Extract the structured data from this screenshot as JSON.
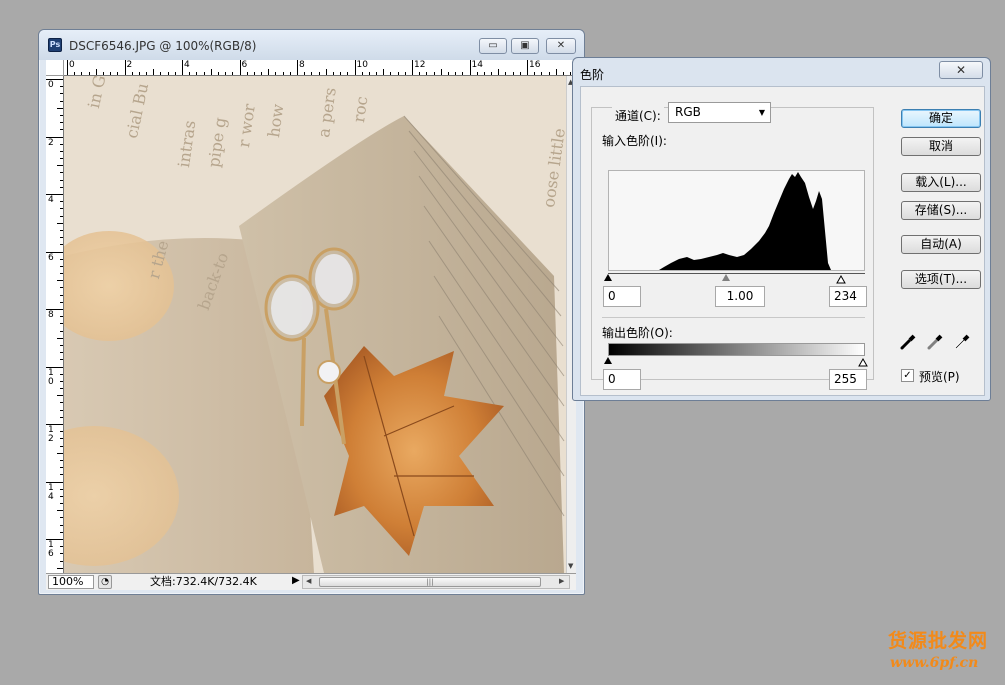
{
  "document_window": {
    "title": "DSCF6546.JPG @ 100%(RGB/8)",
    "app_icon": "Ps",
    "buttons": {
      "minimize": "▭",
      "maximize": "▣",
      "close": "✕"
    },
    "ruler_h_labels": [
      "0",
      "2",
      "4",
      "6",
      "8",
      "10",
      "12",
      "14",
      "16"
    ],
    "ruler_v_labels": [
      "0",
      "2",
      "4",
      "6",
      "8",
      "10",
      "12",
      "14",
      "16"
    ],
    "status": {
      "zoom": "100%",
      "doc_size": "文档:732.4K/732.4K",
      "nav_icon": "navigator-icon"
    },
    "canvas_texts": [
      "in Guan",
      "cial Bu",
      "intras",
      "pipe g",
      "r wor",
      "back-to",
      "r the",
      "how",
      "a pers",
      "oose little",
      "roc"
    ]
  },
  "levels_dialog": {
    "title": "色阶",
    "close": "✕",
    "channel_label": "通道(C):",
    "channel_value": "RGB",
    "input_label": "输入色阶(I):",
    "input_values": {
      "black": "0",
      "gamma": "1.00",
      "white": "234"
    },
    "output_label": "输出色阶(O):",
    "output_values": {
      "black": "0",
      "white": "255"
    },
    "buttons": {
      "ok": "确定",
      "cancel": "取消",
      "load": "载入(L)...",
      "save": "存储(S)...",
      "auto": "自动(A)",
      "options": "选项(T)..."
    },
    "preview_label": "预览(P)",
    "preview_checked": true,
    "preview_mark": "✓"
  },
  "watermark": {
    "line1": "货源批发网",
    "line2": "www.6pf.cn",
    "color": "#f28a1a"
  }
}
